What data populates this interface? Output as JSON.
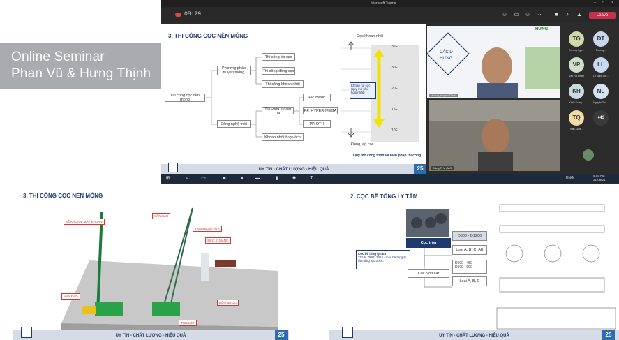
{
  "overlay": {
    "line1": "Online Seminar",
    "line2": "Phan Vũ & Hưng Thịnh"
  },
  "teams": {
    "window_title": "Microsoft Teams",
    "timer": "08:29",
    "leave_label": "Leave",
    "presenter_tiles": [
      {
        "name": "Hoang, Huynh Thinh",
        "slide_fragment_title": "HƯNG",
        "slide_fragment_line1": "CÁC D",
        "slide_fragment_line2": "HƯNG"
      },
      {
        "name": "Đặng T. Vi (MC)"
      }
    ],
    "participants": [
      {
        "initials": "TG",
        "name": "Trương Ngọ...",
        "color": "#cfd8a6"
      },
      {
        "initials": "DT",
        "name": "Trương...",
        "color": "#c9d7ee"
      },
      {
        "initials": "VP",
        "name": "Văn Hà Phạm",
        "color": "#cfe0c9"
      },
      {
        "initials": "LL",
        "name": "Lê Ngọc Loi...",
        "color": "#c7d9ef"
      },
      {
        "initials": "KH",
        "name": "Khấu Trung...",
        "color": "#c9dde0"
      },
      {
        "initials": "NL",
        "name": "Nguyễn Thả...",
        "color": "#d6e4f2"
      },
      {
        "initials": "TQ",
        "name": "Trần Xuân...",
        "color": "#f2dca6"
      },
      {
        "initials": "+43",
        "name": "",
        "color": "#3a3a3a"
      }
    ],
    "clock": {
      "time": "9:05 AM",
      "date": "21/08/21"
    },
    "lang": "ENG"
  },
  "slide_top": {
    "title": "3.  THI CÔNG CỌC NỀN MÓNG",
    "root": "Thi công cọc nền móng",
    "branch1": "Phương pháp truyền thống",
    "branch1_items": [
      "Thi công ép cọc",
      "Thi công đóng cọc",
      "Thi công khoan nhồi"
    ],
    "branch2": "Công nghệ mới",
    "branch2_sub": "Thi công khoan hạ",
    "branch2_sub_items": [
      "PP. Basic",
      "PP. HYPER-MEGA",
      "PP. DTH"
    ],
    "branch2_item2": "Khoan nhồi ống vách",
    "scale_top": "Cọc khoan nhồi",
    "scale_bottom": "Đóng, ép cọc",
    "scale_ticks": [
      "35F",
      "30F",
      "20F",
      "15F",
      "10F"
    ],
    "mid_label": "Khoan hạ cọc (quy mô phù hợp nhất)",
    "caption": "Quy mô công trình và biện pháp thi công",
    "footer": "UY TÍN - CHẤT LƯỢNG - HIỆU QUẢ",
    "badge": "25"
  },
  "slide_bl": {
    "title": "3.  THI CÔNG CỌC NỀN MÓNG",
    "labels": [
      "BỂ KHOAN, MÁY KHOAN",
      "CẦN CẨU",
      "TRẠM BƠM VỮA",
      "SILO XI MĂNG",
      "MÁY ĐÀO",
      "BỒN NƯỚC",
      "TÔN LÓT"
    ],
    "footer": "UY TÍN - CHẤT LƯỢNG - HIỆU QUẢ",
    "badge": "25"
  },
  "slide_br": {
    "title": "2.  CỌC BÊ TÔNG LY TÂM",
    "main_box_title": "Cọc bê tông ly tâm",
    "main_box_text": "TCVN 7888: 2014 - Cọc bê tông ly tâm ứng lực trước",
    "round_label": "Cọc tròn",
    "round_specs": [
      "D300 - D1200",
      "Loại A, B, C, AB"
    ],
    "nodular_label": "Cọc Nodular",
    "nodular_specs": [
      "D600 - 450",
      "D600 - 600",
      "Loại A, B, C"
    ],
    "footer": "UY TÍN - CHẤT LƯỢNG - HIỆU QUẢ",
    "badge": "25"
  }
}
